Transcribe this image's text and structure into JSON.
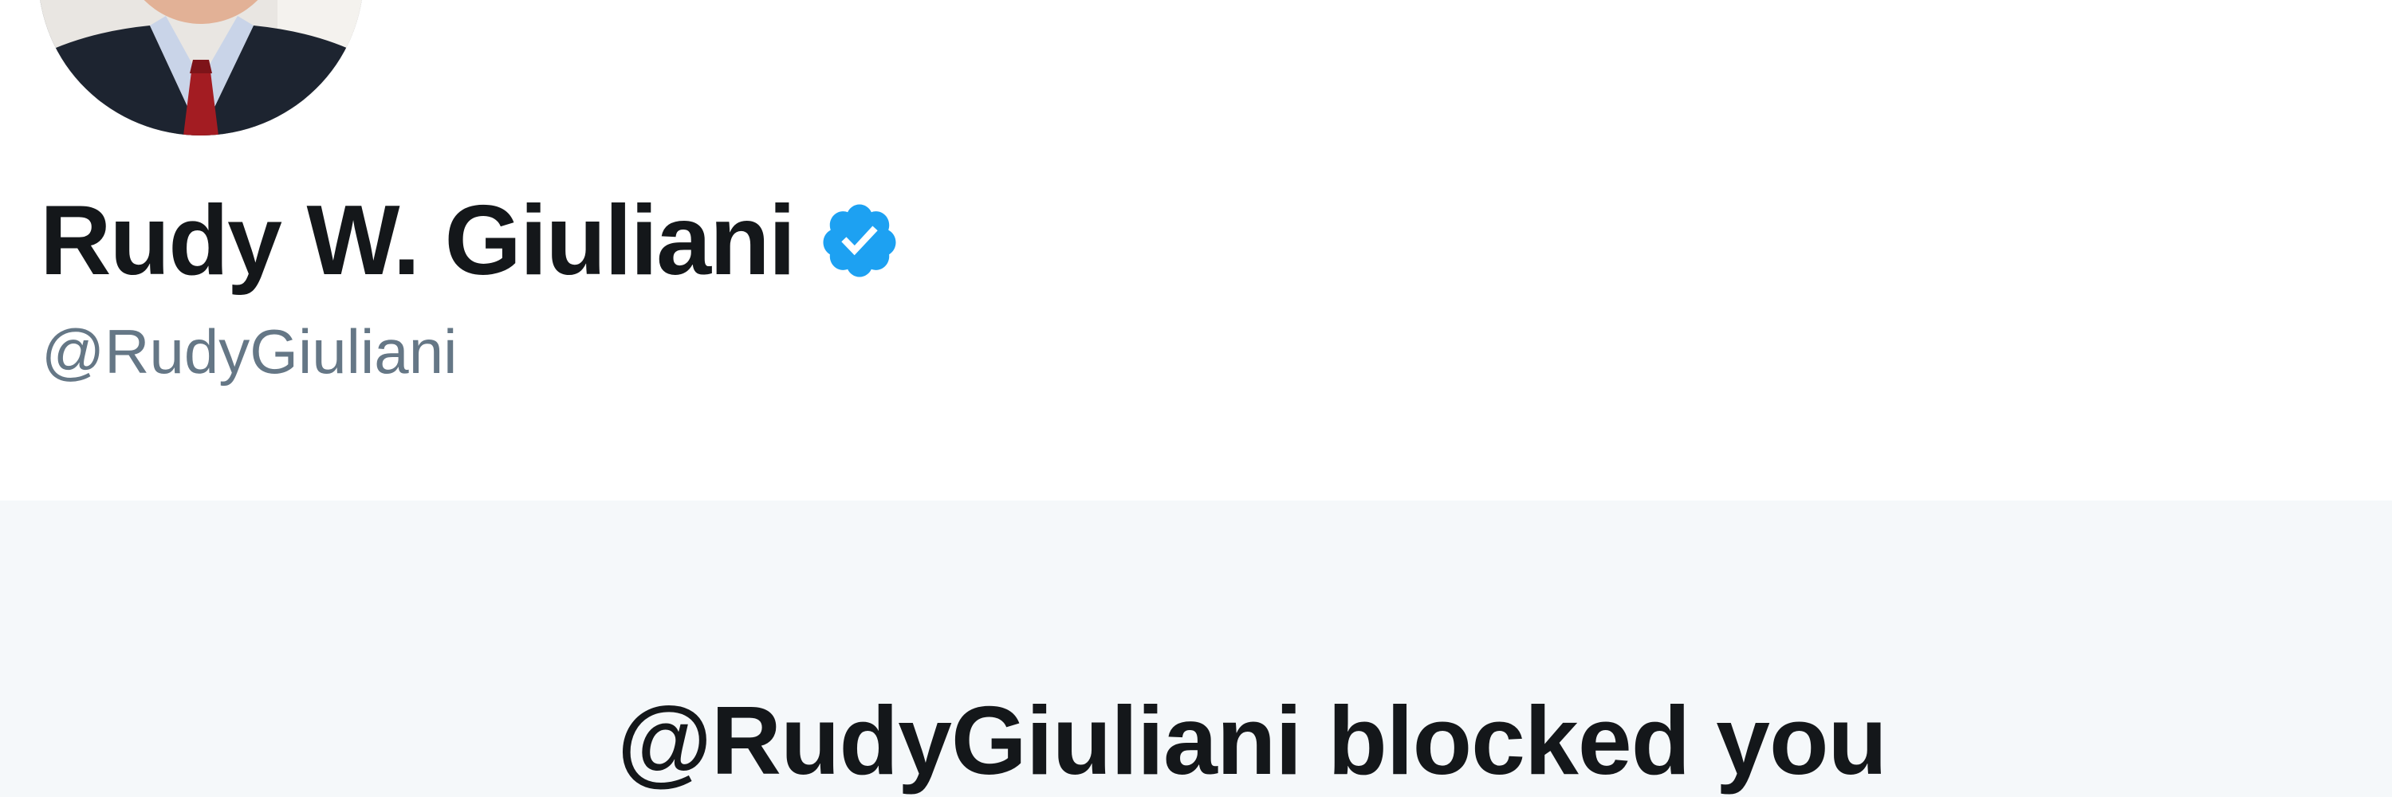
{
  "profile": {
    "display_name": "Rudy W. Giuliani",
    "handle": "@RudyGiuliani",
    "verified": true,
    "verified_icon": "verified-badge-icon",
    "avatar_icon": "profile-photo"
  },
  "blocked_notice": {
    "title": "@RudyGiuliani blocked you"
  },
  "colors": {
    "name_text": "#14171a",
    "handle_text": "#657786",
    "verified_blue": "#1da1f2",
    "panel_background": "#f5f8fa",
    "header_background": "#ffffff"
  }
}
